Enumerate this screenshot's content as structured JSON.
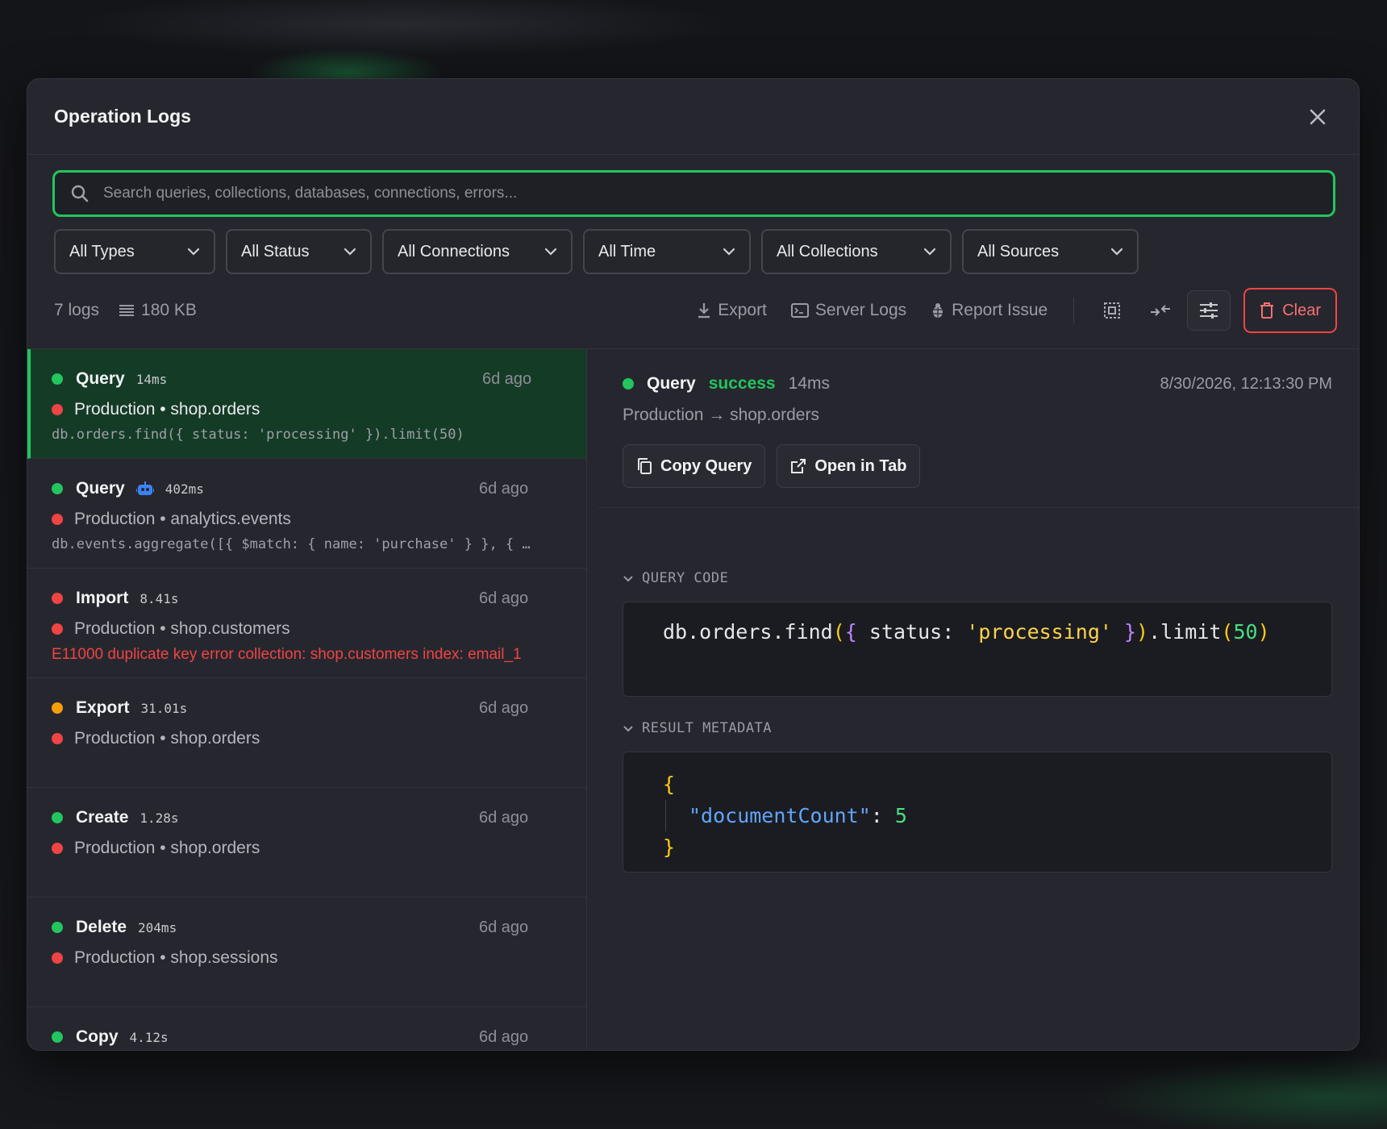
{
  "modal": {
    "title": "Operation Logs"
  },
  "search": {
    "placeholder": "Search queries, collections, databases, connections, errors..."
  },
  "filters": [
    {
      "label": "All Types"
    },
    {
      "label": "All Status"
    },
    {
      "label": "All Connections"
    },
    {
      "label": "All Time"
    },
    {
      "label": "All Collections"
    },
    {
      "label": "All Sources"
    }
  ],
  "toolbar": {
    "log_count": "7 logs",
    "size": "180 KB",
    "export_label": "Export",
    "server_logs_label": "Server Logs",
    "report_issue_label": "Report Issue",
    "clear_label": "Clear"
  },
  "logs": [
    {
      "type": "Query",
      "duration": "14ms",
      "ago": "6d ago",
      "status_color": "#22c55e",
      "conn_color": "#ef4444",
      "connection": "Production • shop.orders",
      "detail": "db.orders.find({ status: 'processing' }).limit(50)",
      "is_error": false,
      "selected": true,
      "ai": false
    },
    {
      "type": "Query",
      "duration": "402ms",
      "ago": "6d ago",
      "status_color": "#22c55e",
      "conn_color": "#ef4444",
      "connection": "Production • analytics.events",
      "detail": "db.events.aggregate([{ $match: { name: 'purchase' } }, { …",
      "is_error": false,
      "selected": false,
      "ai": true
    },
    {
      "type": "Import",
      "duration": "8.41s",
      "ago": "6d ago",
      "status_color": "#ef4444",
      "conn_color": "#ef4444",
      "connection": "Production • shop.customers",
      "detail": "E11000 duplicate key error collection: shop.customers index: email_1",
      "is_error": true,
      "selected": false,
      "ai": false
    },
    {
      "type": "Export",
      "duration": "31.01s",
      "ago": "6d ago",
      "status_color": "#f59e0b",
      "conn_color": "#ef4444",
      "connection": "Production • shop.orders",
      "detail": "",
      "is_error": false,
      "selected": false,
      "ai": false
    },
    {
      "type": "Create",
      "duration": "1.28s",
      "ago": "6d ago",
      "status_color": "#22c55e",
      "conn_color": "#ef4444",
      "connection": "Production • shop.orders",
      "detail": "",
      "is_error": false,
      "selected": false,
      "ai": false
    },
    {
      "type": "Delete",
      "duration": "204ms",
      "ago": "6d ago",
      "status_color": "#22c55e",
      "conn_color": "#ef4444",
      "connection": "Production • shop.sessions",
      "detail": "",
      "is_error": false,
      "selected": false,
      "ai": false
    },
    {
      "type": "Copy",
      "duration": "4.12s",
      "ago": "6d ago",
      "status_color": "#22c55e",
      "conn_color": "#ef4444",
      "connection": "",
      "detail": "",
      "is_error": false,
      "selected": false,
      "ai": false
    }
  ],
  "detail": {
    "type": "Query",
    "status": "success",
    "duration": "14ms",
    "timestamp": "8/30/2026, 12:13:30 PM",
    "path": "Production → shop.orders",
    "copy_query_label": "Copy Query",
    "open_in_tab_label": "Open in Tab",
    "query_code_label": "QUERY CODE",
    "query_code": {
      "prefix": "db.orders.find",
      "open_paren": "(",
      "open_brace": "{",
      "key": " status: ",
      "value": "'processing'",
      "close_brace": " }",
      "close_paren": ")",
      "method": ".limit",
      "arg_open": "(",
      "arg": "50",
      "arg_close": ")"
    },
    "result_metadata_label": "RESULT METADATA",
    "result": {
      "open": "{",
      "key": "\"documentCount\"",
      "colon": ": ",
      "value": "5",
      "close": "}"
    }
  }
}
